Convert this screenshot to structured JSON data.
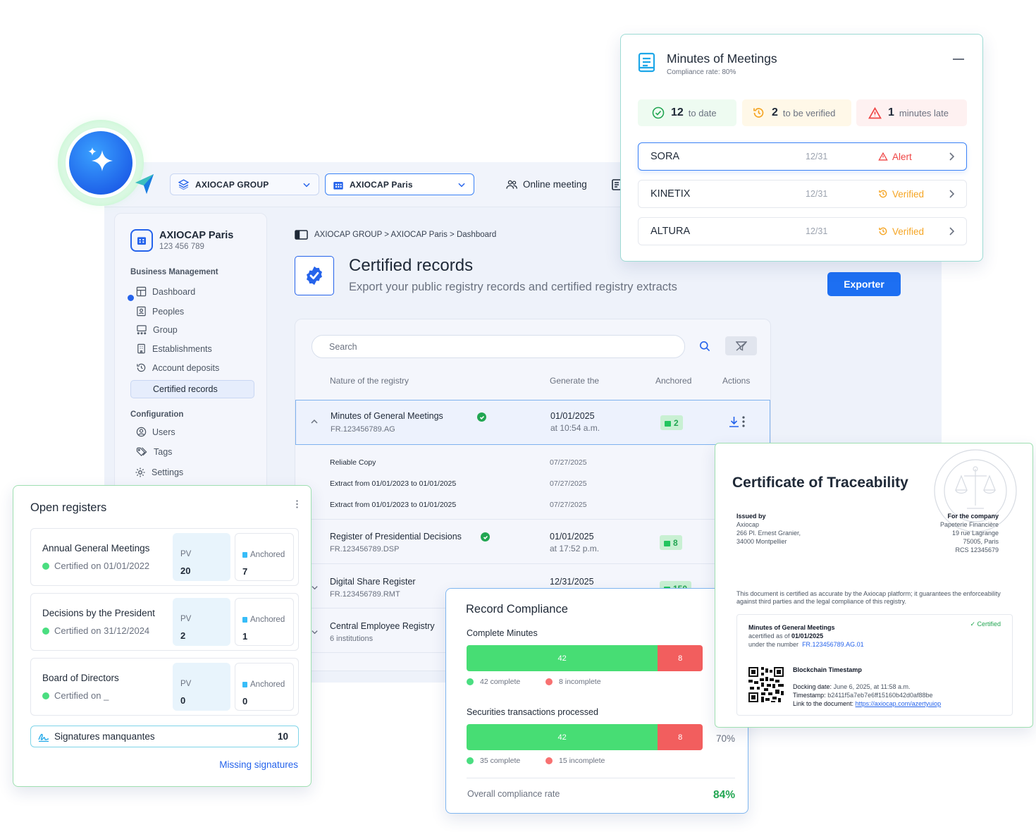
{
  "app": {
    "group_select": "AXIOCAP GROUP",
    "entity_select": "AXIOCAP Paris",
    "online_meeting": "Online meeting"
  },
  "sidebar": {
    "org_name": "AXIOCAP Paris",
    "org_id": "123 456 789",
    "business_title": "Business Management",
    "business_items": [
      "Dashboard",
      "Peoples",
      "Group",
      "Establishments",
      "Account deposits",
      "Certified records"
    ],
    "config_title": "Configuration",
    "config_items": [
      "Users",
      "Tags",
      "Settings"
    ]
  },
  "main": {
    "breadcrumb": "AXIOCAP GROUP > AXIOCAP Paris > Dashboard",
    "title": "Certified records",
    "subtitle": "Export your public registry records and certified registry extracts",
    "export_label": "Exporter",
    "search_placeholder": "Search",
    "columns": [
      "Nature of the registry",
      "Generate the",
      "Anchored",
      "Actions"
    ],
    "rows": [
      {
        "title": "Minutes of General Meetings",
        "ref": "FR.123456789.AG",
        "date": "01/01/2025",
        "time": "at 10:54 a.m.",
        "anchored": "2"
      },
      {
        "title": "Register of Presidential Decisions",
        "ref": "FR.123456789.DSP",
        "date": "01/01/2025",
        "time": "at 17:52 p.m.",
        "anchored": "8"
      },
      {
        "title": "Digital Share Register",
        "ref": "FR.123456789.RMT",
        "date": "12/31/2025",
        "time": "",
        "anchored": "150"
      },
      {
        "title": "Central Employee Registry",
        "ref": "6 institutions",
        "date": "",
        "time": "",
        "anchored": ""
      }
    ],
    "sub_rows": [
      {
        "label": "Reliable Copy",
        "date": "07/27/2025"
      },
      {
        "label": "Extract from 01/01/2023 to 01/01/2025",
        "date": "07/27/2025"
      },
      {
        "label": "Extract from 01/01/2023 to 01/01/2025",
        "date": "07/27/2025"
      }
    ]
  },
  "minutes": {
    "title": "Minutes of Meetings",
    "compliance": "Compliance rate: 80%",
    "kpis": [
      {
        "value": "12",
        "label": "to date"
      },
      {
        "value": "2",
        "label": "to be verified"
      },
      {
        "value": "1",
        "label": "minutes late"
      }
    ],
    "companies": [
      {
        "name": "SORA",
        "date": "12/31",
        "status": "Alert"
      },
      {
        "name": "KINETIX",
        "date": "12/31",
        "status": "Verified"
      },
      {
        "name": "ALTURA",
        "date": "12/31",
        "status": "Verified"
      }
    ],
    "colors": {
      "ok": "#22a652",
      "warn": "#f5a524",
      "alert": "#ef4444"
    }
  },
  "registers": {
    "title": "Open registers",
    "pv_label": "PV",
    "anchored_label": "Anchored",
    "items": [
      {
        "title": "Annual General Meetings",
        "certified": "Certified on 01/01/2022",
        "pv": "20",
        "anchored": "7"
      },
      {
        "title": "Decisions by the President",
        "certified": "Certified on 31/12/2024",
        "pv": "2",
        "anchored": "1"
      },
      {
        "title": "Board of Directors",
        "certified": "Certified on _",
        "pv": "0",
        "anchored": "0"
      }
    ],
    "signatures_label": "Signatures manquantes",
    "signatures_count": "10",
    "missing_link": "Missing signatures"
  },
  "compliance": {
    "title": "Record Compliance",
    "blocks": [
      {
        "label": "Complete Minutes",
        "green": "42",
        "red": "8",
        "green_fraction": 0.81,
        "legend_ok": "42 complete",
        "legend_ko": "8 incomplete"
      },
      {
        "label": "Securities transactions processed",
        "green": "42",
        "red": "8",
        "green_fraction": 0.81,
        "legend_ok": "35 complete",
        "legend_ko": "15 incomplete",
        "side_pct": "70%"
      }
    ],
    "overall_label": "Overall compliance rate",
    "overall_value": "84%"
  },
  "certificate": {
    "title": "Certificate of Traceability",
    "issued_by_label": "Issued by",
    "issuer": [
      "Axiocap",
      "266 Pl. Ernest Granier,",
      "34000 Montpellier"
    ],
    "for_label": "For the company",
    "company": [
      "Papeterie Financière",
      "19 rue Lagrange",
      "75005, Paris",
      "RCS 12345679"
    ],
    "statement": "This document is certified as accurate by the Axiocap platform; it guarantees the enforceability against third parties and the legal compliance of this registry.",
    "doc_title": "Minutes of General Meetings",
    "certified_badge": "Certified",
    "acertified_prefix": "acertified as of",
    "acertified_date": "01/01/2025",
    "number_prefix": "under the number",
    "number": "FR.123456789.AG.01",
    "blockchain_title": "Blockchain Timestamp",
    "docking_label": "Docking date:",
    "docking_value": "June 6, 2025, at 11:58 a.m.",
    "timestamp_label": "Timestamp:",
    "timestamp_value": "b2411f5a7eb7e6ff15160b42d0af88be",
    "link_label": "Link to the document:",
    "link_value": "https://axiocap.com/azertyuiop"
  }
}
